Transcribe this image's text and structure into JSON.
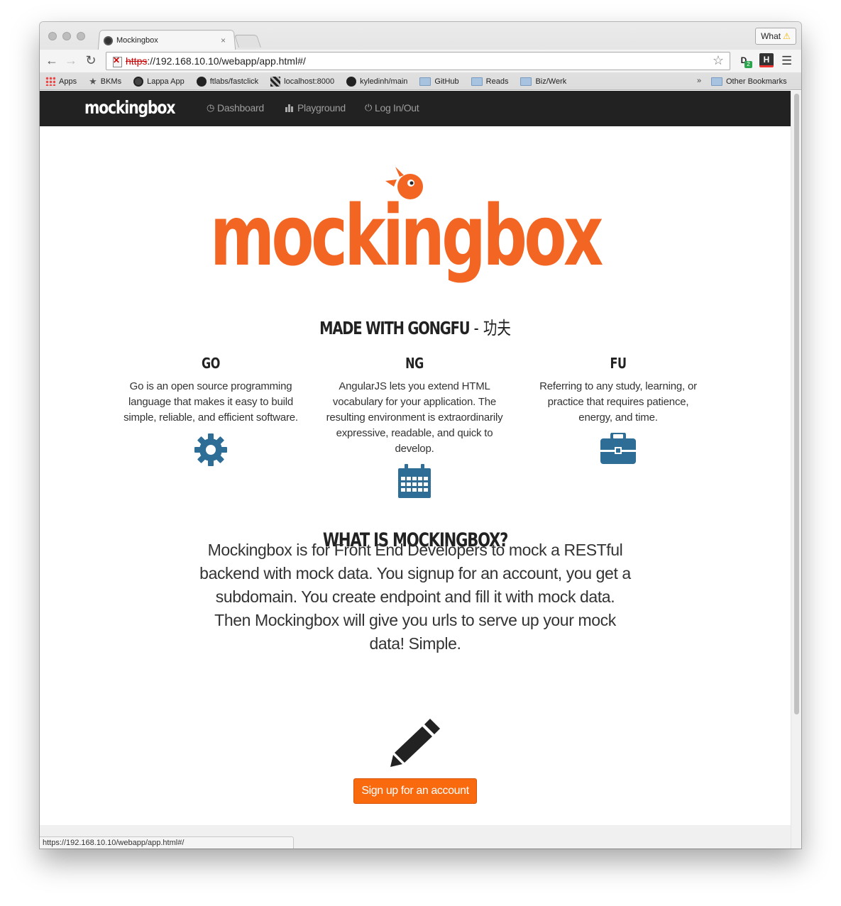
{
  "browser": {
    "tab_title": "Mockingbox",
    "tab_close": "×",
    "what_label": "What",
    "url_scheme": "https",
    "url_rest": "://192.168.10.10/webapp/app.html#/",
    "bookmarks": [
      "Apps",
      "BKMs",
      "Lappa App",
      "ftlabs/fastclick",
      "localhost:8000",
      "kyledinh/main",
      "GitHub",
      "Reads",
      "Biz/Werk"
    ],
    "bookmarks_more": "»",
    "other_bookmarks": "Other Bookmarks",
    "ext_d_badge": "2",
    "ext_h": "H",
    "ext_d": "D",
    "status_url": "https://192.168.10.10/webapp/app.html#/"
  },
  "nav": {
    "brand": "mockingbox",
    "items": [
      "Dashboard",
      "Playground",
      "Log In/Out"
    ]
  },
  "hero": {
    "logo": "mockingbox"
  },
  "gongfu": {
    "title": "MADE WITH GONGFU",
    "subtitle": " - 功夫",
    "columns": [
      {
        "title": "GO",
        "text": "Go is an open source programming language that makes it easy to build simple, reliable, and efficient software.",
        "icon": "gear-icon"
      },
      {
        "title": "NG",
        "text": "AngularJS lets you extend HTML vocabulary for your application. The resulting environment is extraordinarily expressive, readable, and quick to develop.",
        "icon": "calendar-icon"
      },
      {
        "title": "FU",
        "text": "Referring to any study, learning, or practice that requires patience, energy, and time.",
        "icon": "briefcase-icon"
      }
    ]
  },
  "about": {
    "title": "WHAT IS MOCKINGBOX?",
    "text": "Mockingbox is for Front End Developers to mock a RESTful backend with mock data. You signup for an account, you get a subdomain. You create endpoint and fill it with mock data. Then Mockingbox will give you urls to serve up your mock data! Simple."
  },
  "cta": {
    "label": "Sign up for an account"
  },
  "colors": {
    "brand_orange": "#f26522",
    "button_orange": "#f96a0e",
    "icon_blue": "#2e6d96",
    "navbar": "#222222"
  }
}
